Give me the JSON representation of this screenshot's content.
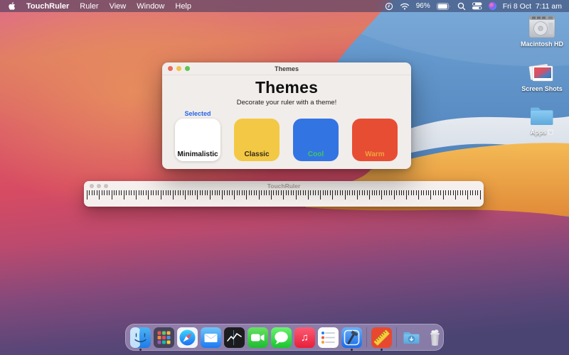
{
  "menu_bar": {
    "menus": [
      "TouchRuler",
      "Ruler",
      "View",
      "Window",
      "Help"
    ],
    "battery_percent": "96%",
    "clock": "Fri 8 Oct  7:11 am"
  },
  "desktop": {
    "icons": [
      {
        "label": "Macintosh HD"
      },
      {
        "label": "Screen Shots"
      },
      {
        "label": "Apps"
      }
    ]
  },
  "themes_window": {
    "titlebar_title": "Themes",
    "heading": "Themes",
    "subtitle": "Decorate your ruler with a theme!",
    "selected_badge": "Selected",
    "selected_color": "#2563E8",
    "swatches": [
      {
        "name": "Minimalistic",
        "bg": "#FFFFFF",
        "text": "#111111",
        "selected": true
      },
      {
        "name": "Classic",
        "bg": "#F3C844",
        "text": "#32281A",
        "selected": false
      },
      {
        "name": "Cool",
        "bg": "#3374E3",
        "text": "#41C75D",
        "selected": false
      },
      {
        "name": "Warm",
        "bg": "#E74D33",
        "text": "#EFA23E",
        "selected": false
      }
    ]
  },
  "ruler_window": {
    "titlebar_title": "TouchRuler",
    "tick_groups": 32,
    "ticks_per_group": 5
  },
  "dock": {
    "items": [
      "finder",
      "launchpad",
      "safari",
      "mail",
      "stocks",
      "facetime",
      "messages",
      "music",
      "reminders",
      "xcode",
      "touchruler",
      "downloads",
      "trash"
    ],
    "running": [
      "finder",
      "xcode",
      "touchruler"
    ],
    "music_glyph": "♫"
  }
}
